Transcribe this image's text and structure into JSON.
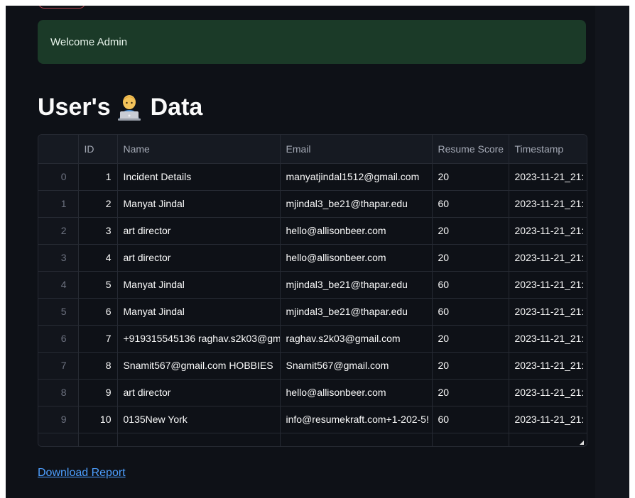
{
  "alert": {
    "message": "Welcome Admin"
  },
  "page": {
    "title_prefix": "User's",
    "title_suffix": "Data",
    "emoji": "technologist-emoji"
  },
  "table": {
    "headers": {
      "id": "ID",
      "name": "Name",
      "email": "Email",
      "score": "Resume Score",
      "timestamp": "Timestamp"
    },
    "rows": [
      {
        "index": "0",
        "id": "1",
        "name": "Incident Details",
        "email": "manyatjindal1512@gmail.com",
        "score": "20",
        "timestamp": "2023-11-21_21:"
      },
      {
        "index": "1",
        "id": "2",
        "name": "Manyat Jindal",
        "email": "mjindal3_be21@thapar.edu",
        "score": "60",
        "timestamp": "2023-11-21_21:"
      },
      {
        "index": "2",
        "id": "3",
        "name": "art director",
        "email": "hello@allisonbeer.com",
        "score": "20",
        "timestamp": "2023-11-21_21:"
      },
      {
        "index": "3",
        "id": "4",
        "name": "art director",
        "email": "hello@allisonbeer.com",
        "score": "20",
        "timestamp": "2023-11-21_21:"
      },
      {
        "index": "4",
        "id": "5",
        "name": "Manyat Jindal",
        "email": "mjindal3_be21@thapar.edu",
        "score": "60",
        "timestamp": "2023-11-21_21:"
      },
      {
        "index": "5",
        "id": "6",
        "name": "Manyat Jindal",
        "email": "mjindal3_be21@thapar.edu",
        "score": "60",
        "timestamp": "2023-11-21_21:"
      },
      {
        "index": "6",
        "id": "7",
        "name": "+919315545136 raghav.s2k03@gm",
        "email": "raghav.s2k03@gmail.com",
        "score": "20",
        "timestamp": "2023-11-21_21:"
      },
      {
        "index": "7",
        "id": "8",
        "name": "Snamit567@gmail.com HOBBIES",
        "email": "Snamit567@gmail.com",
        "score": "20",
        "timestamp": "2023-11-21_21:"
      },
      {
        "index": "8",
        "id": "9",
        "name": "art director",
        "email": "hello@allisonbeer.com",
        "score": "20",
        "timestamp": "2023-11-21_21:"
      },
      {
        "index": "9",
        "id": "10",
        "name": "0135New York",
        "email": "info@resumekraft.com+1-202-5!",
        "score": "60",
        "timestamp": "2023-11-21_21:"
      }
    ]
  },
  "footer": {
    "download_label": "Download Report"
  },
  "colors": {
    "background": "#0e1117",
    "alert_bg": "#1b3a28",
    "link": "#4d9fff"
  }
}
